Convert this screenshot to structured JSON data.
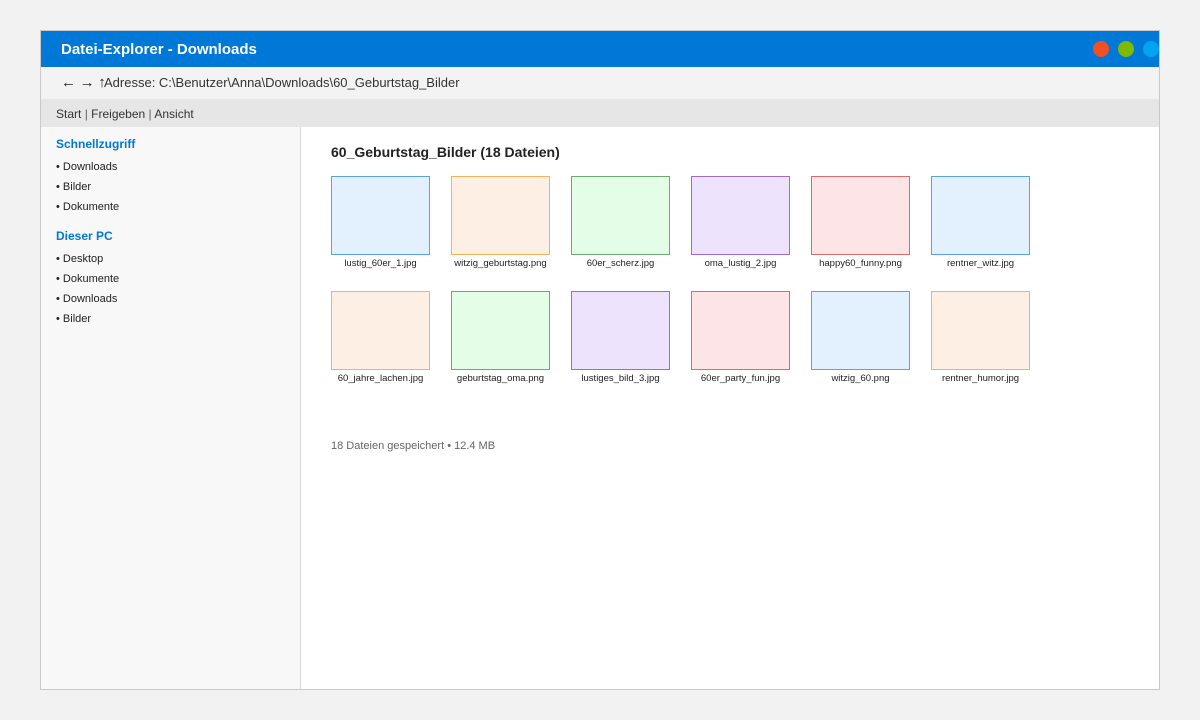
{
  "window": {
    "title": "Datei-Explorer - Downloads",
    "controls": {
      "close_color": "#f25022",
      "maximize_color": "#7fba00",
      "minimize_color": "#00a4ef"
    }
  },
  "addressbar": {
    "back_icon": "←",
    "forward_icon": "→",
    "up_icon": "↑",
    "address_text": "Adresse: C:\\Benutzer\\Anna\\Downloads\\60_Geburtstag_Bilder"
  },
  "ribbon": {
    "tabs": [
      "Start",
      "Freigeben",
      "Ansicht"
    ],
    "separator": "|"
  },
  "sidebar": {
    "quick_access_heading": "Schnellzugriff",
    "quick_access_items": [
      "• Downloads",
      "• Bilder",
      "• Dokumente"
    ],
    "this_pc_heading": "Dieser PC",
    "this_pc_items": [
      "• Desktop",
      "• Dokumente",
      "• Downloads",
      "• Bilder"
    ]
  },
  "main": {
    "folder_title": "60_Geburtstag_Bilder (18 Dateien)",
    "files": [
      {
        "name": "lustig_60er_1.jpg",
        "color": "blue"
      },
      {
        "name": "witzig_geburtstag.png",
        "color": "orange"
      },
      {
        "name": "60er_scherz.jpg",
        "color": "green"
      },
      {
        "name": "oma_lustig_2.jpg",
        "color": "purple"
      },
      {
        "name": "happy60_funny.png",
        "color": "red"
      },
      {
        "name": "rentner_witz.jpg",
        "color": "blue"
      },
      {
        "name": "60_jahre_lachen.jpg",
        "color": "orange"
      },
      {
        "name": "geburtstag_oma.png",
        "color": "green"
      },
      {
        "name": "lustiges_bild_3.jpg",
        "color": "purple"
      },
      {
        "name": "60er_party_fun.jpg",
        "color": "red"
      },
      {
        "name": "witzig_60.png",
        "color": "blue"
      },
      {
        "name": "rentner_humor.jpg",
        "color": "orange"
      }
    ],
    "status_text": "18 Dateien gespeichert • 12.4 MB"
  },
  "colors": {
    "accent": "#0078d7",
    "thumb_palette": {
      "blue": {
        "fill": "#e3f0fd",
        "border": "#5aa3e0"
      },
      "orange": {
        "fill": "#fdefe3",
        "border": "#f0b45a"
      },
      "green": {
        "fill": "#e3fde6",
        "border": "#6aab6f"
      },
      "purple": {
        "fill": "#eee3fd",
        "border": "#a06bd0"
      },
      "red": {
        "fill": "#fde5e7",
        "border": "#db6a6a"
      }
    }
  }
}
